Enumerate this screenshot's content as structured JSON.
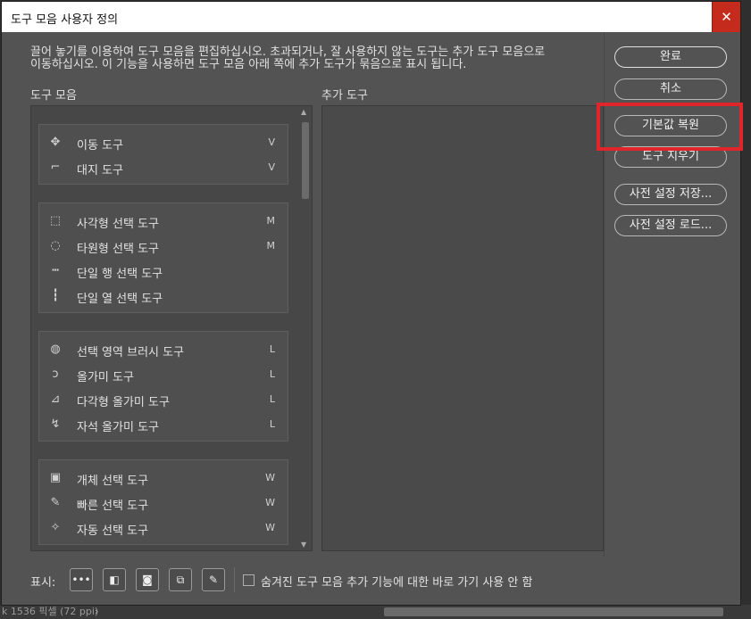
{
  "dialog": {
    "title": "도구 모음 사용자 정의",
    "close": "✕",
    "description_line1": "끌어 놓기를 이용하여 도구 모음을 편집하십시오. 초과되거나, 잘 사용하지 않는 도구는 추가 도구 모음으로",
    "description_line2": "이동하십시오. 이 기능을 사용하면 도구 모음 아래 쪽에 추가 도구가 묶음으로 표시 됩니다.",
    "toolbar_label": "도구 모음",
    "extra_label": "추가 도구"
  },
  "groups": [
    {
      "items": [
        {
          "icon": "move-icon",
          "glyph": "✥",
          "name": "이동 도구",
          "shortcut": "V"
        },
        {
          "icon": "artboard-icon",
          "glyph": "⌐",
          "name": "대지 도구",
          "shortcut": "V"
        }
      ]
    },
    {
      "items": [
        {
          "icon": "rect-marquee-icon",
          "glyph": "⬚",
          "name": "사각형 선택 도구",
          "shortcut": "M"
        },
        {
          "icon": "ellipse-marquee-icon",
          "glyph": "◌",
          "name": "타원형 선택 도구",
          "shortcut": "M"
        },
        {
          "icon": "row-marquee-icon",
          "glyph": "┅",
          "name": "단일 행 선택 도구",
          "shortcut": ""
        },
        {
          "icon": "column-marquee-icon",
          "glyph": "┇",
          "name": "단일 열 선택 도구",
          "shortcut": ""
        }
      ]
    },
    {
      "items": [
        {
          "icon": "selection-brush-icon",
          "glyph": "◍",
          "name": "선택 영역 브러시 도구",
          "shortcut": "L"
        },
        {
          "icon": "lasso-icon",
          "glyph": "ↄ",
          "name": "올가미 도구",
          "shortcut": "L"
        },
        {
          "icon": "polygonal-lasso-icon",
          "glyph": "⊿",
          "name": "다각형 올가미 도구",
          "shortcut": "L"
        },
        {
          "icon": "magnetic-lasso-icon",
          "glyph": "↯",
          "name": "자석 올가미 도구",
          "shortcut": "L"
        }
      ]
    },
    {
      "items": [
        {
          "icon": "object-select-icon",
          "glyph": "▣",
          "name": "개체 선택 도구",
          "shortcut": "W"
        },
        {
          "icon": "quick-select-icon",
          "glyph": "✎",
          "name": "빠른 선택 도구",
          "shortcut": "W"
        },
        {
          "icon": "magic-wand-icon",
          "glyph": "✧",
          "name": "자동 선택 도구",
          "shortcut": "W"
        }
      ]
    }
  ],
  "buttons": {
    "done": "완료",
    "cancel": "취소",
    "restore_defaults": "기본값 복원",
    "clear_tools": "도구 지우기",
    "save_preset": "사전 설정 저장...",
    "load_preset": "사전 설정 로드..."
  },
  "footer": {
    "show_label": "표시:",
    "checkbox_label": "숨겨진 도구 모음 추가 기능에 대한 바로 가기 사용 안 함",
    "icons": [
      "more-icon",
      "foreground-background-icon",
      "quick-mask-icon",
      "screen-mode-icon",
      "edit-toolbar-icon"
    ]
  },
  "statusbar": {
    "text": "k 1536 픽셀 (72 ppi)",
    "chevron": "›"
  },
  "colors": {
    "highlight": "#e0262a",
    "close": "#c42b1c",
    "dialog_bg": "#535353"
  }
}
